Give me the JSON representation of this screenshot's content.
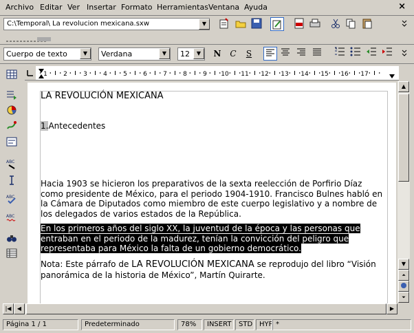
{
  "menu": {
    "items": [
      "Archivo",
      "Editar",
      "Ver",
      "Insertar",
      "Formato",
      "Herramientas",
      "Ventana",
      "Ayuda"
    ],
    "close": "×"
  },
  "toolbar": {
    "url_value": "C:\\Temporal\\ La revolucion mexicana.sxw"
  },
  "format": {
    "style_value": "Cuerpo de texto",
    "font_value": "Verdana",
    "size_value": "12",
    "bold": "N",
    "italic": "C",
    "underline": "S"
  },
  "ruler": {
    "numbers": [
      "1",
      "2",
      "3",
      "4",
      "5",
      "6",
      "7",
      "8",
      "9",
      "10",
      "11",
      "12",
      "13",
      "14",
      "15",
      "16",
      "17"
    ]
  },
  "document": {
    "title": "LA REVOLUCIÓN MEXICANA",
    "heading_number": "1.",
    "heading": "Antecedentes",
    "para1": "Hacia 1903 se hicieron los preparativos de la sexta reelección de Porfirio Díaz como presidente de México, para el periodo 1904-1910. Francisco Bulnes habló en la Cámara de Diputados como miembro de este cuerpo legislativo y a nombre de los delegados de varios estados de la República.",
    "para2": "En los primeros años del siglo XX, la juventud de la época y las personas que entraban en el periodo de la madurez, tenían la convicción del peligro que representaba para México la falta de un gobierno democrático.",
    "para3_prefix": "Nota: Este párrafo de ",
    "para3_title": "LA REVOLUCIÓN MEXICANA",
    "para3_suffix": " se reprodujo del libro “Visión panorámica de la historia de México”, Martín Quirarte."
  },
  "status": {
    "page": "Página  1 / 1",
    "style": "Predeterminado",
    "zoom": "78%",
    "insert": "INSERT",
    "std": "STD",
    "hyp": "HYP",
    "modified": "*"
  }
}
